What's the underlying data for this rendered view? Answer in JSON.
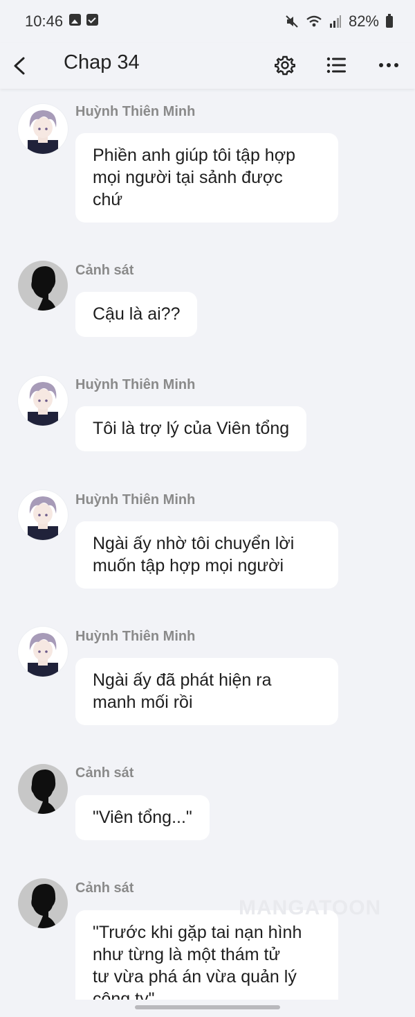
{
  "status_bar": {
    "time": "10:46",
    "battery": "82%",
    "left_icons": [
      "gallery-icon",
      "check-square-icon"
    ],
    "right_icons": [
      "mute-icon",
      "wifi-icon",
      "signal-icon",
      "battery-icon"
    ]
  },
  "header": {
    "title": "Chap 34",
    "icons": [
      "back-arrow-icon",
      "gear-icon",
      "list-icon",
      "more-dots-icon"
    ]
  },
  "colors": {
    "background": "#f2f3f7",
    "bubble": "#ffffff",
    "sender_name": "#8a8a8a",
    "text": "#1e1e1e"
  },
  "watermark": "MANGATOON",
  "messages": [
    {
      "sender": "Huỳnh Thiên Minh",
      "avatar": "anime-man-avatar",
      "lines": [
        "Phiền anh giúp tôi tập hợp",
        "mọi người tại sảnh được",
        "chứ"
      ]
    },
    {
      "sender": "Cảnh sát",
      "avatar": "silhouette-avatar",
      "lines": [
        "Cậu là ai??"
      ]
    },
    {
      "sender": "Huỳnh Thiên Minh",
      "avatar": "anime-man-avatar",
      "lines": [
        "Tôi là trợ lý của Viên tổng"
      ]
    },
    {
      "sender": "Huỳnh Thiên Minh",
      "avatar": "anime-man-avatar",
      "lines": [
        "Ngài ấy nhờ tôi chuyển lời",
        "muốn tập hợp mọi người"
      ]
    },
    {
      "sender": "Huỳnh Thiên Minh",
      "avatar": "anime-man-avatar",
      "lines": [
        "Ngài ấy đã phát hiện ra",
        "manh mối rồi"
      ]
    },
    {
      "sender": "Cảnh sát",
      "avatar": "silhouette-avatar",
      "lines": [
        "\"Viên tổng...\""
      ]
    },
    {
      "sender": "Cảnh sát",
      "avatar": "silhouette-avatar",
      "lines": [
        "\"Trước khi gặp tai nạn hình",
        "như từng là một thám tử",
        "tư vừa phá án vừa quản lý",
        "công ty\""
      ]
    }
  ]
}
